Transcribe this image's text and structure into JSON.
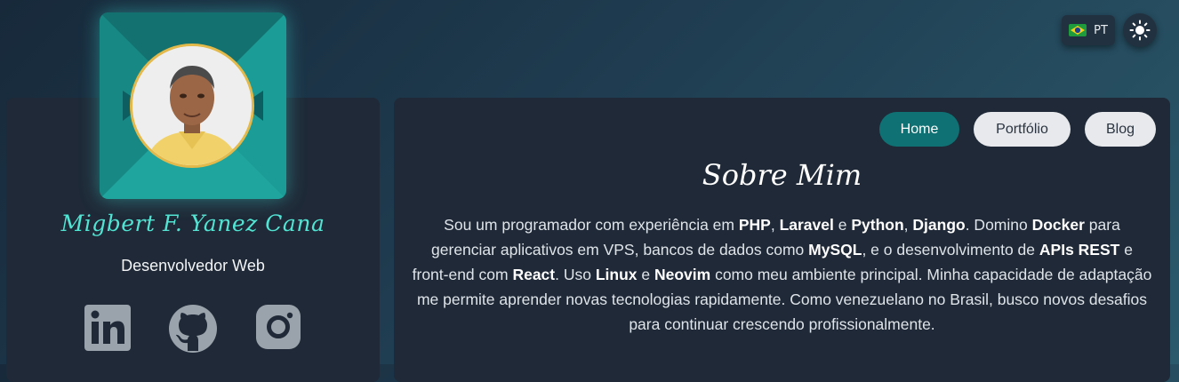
{
  "language": {
    "code": "PT",
    "flag_icon": "brazil-flag-icon"
  },
  "theme_toggle": {
    "icon": "sun-icon"
  },
  "profile": {
    "name": "Migbert F. Yanez Cana",
    "role": "Desenvolvedor Web",
    "social": [
      {
        "name": "linkedin",
        "icon": "linkedin-icon"
      },
      {
        "name": "github",
        "icon": "github-icon"
      },
      {
        "name": "instagram",
        "icon": "instagram-icon"
      }
    ]
  },
  "nav": {
    "home": "Home",
    "portfolio": "Portfólio",
    "blog": "Blog"
  },
  "about": {
    "title": "Sobre Mim",
    "t1": "Sou um programador com experiência em ",
    "php": "PHP",
    "t2": ", ",
    "laravel": "Laravel",
    "t3": " e ",
    "python": "Python",
    "t4": ", ",
    "django": "Django",
    "t5": ". Domino ",
    "docker": "Docker",
    "t6": " para gerenciar aplicativos em VPS, bancos de dados como ",
    "mysql": "MySQL",
    "t7": ", e o desenvolvimento de ",
    "apis": "APIs REST",
    "t8": " e front-end com ",
    "react": "React",
    "t9": ". Uso ",
    "linux": "Linux",
    "t10": " e ",
    "neovim": "Neovim",
    "t11": " como meu ambiente principal. Minha capacidade de adaptação me permite aprender novas tecnologias rapidamente. Como venezuelano no Brasil, busco novos desafios para continuar crescendo profissionalmente."
  },
  "colors": {
    "accent": "#52e4d3",
    "home_button": "#0f7173",
    "card_bg": "#1f2937",
    "frame_teal": "#1aa39c"
  }
}
